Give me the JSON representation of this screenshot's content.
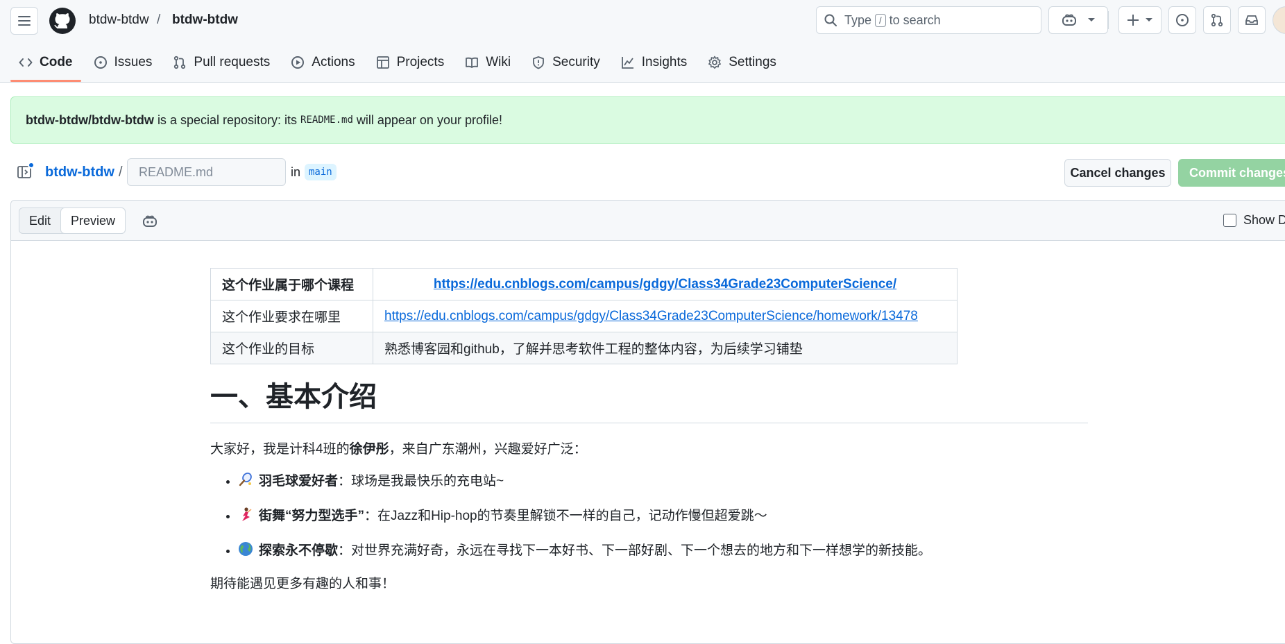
{
  "header": {
    "owner": "btdw-btdw",
    "separator": "/",
    "repo": "btdw-btdw",
    "search_prefix": "Type",
    "search_key": "/",
    "search_suffix": "to search"
  },
  "tabs": [
    {
      "label": "Code",
      "icon": "code-icon",
      "active": true
    },
    {
      "label": "Issues",
      "icon": "issue-icon"
    },
    {
      "label": "Pull requests",
      "icon": "pull-request-icon"
    },
    {
      "label": "Actions",
      "icon": "play-icon"
    },
    {
      "label": "Projects",
      "icon": "table-icon"
    },
    {
      "label": "Wiki",
      "icon": "book-icon"
    },
    {
      "label": "Security",
      "icon": "shield-icon"
    },
    {
      "label": "Insights",
      "icon": "graph-icon"
    },
    {
      "label": "Settings",
      "icon": "gear-icon"
    }
  ],
  "banner": {
    "repo_full": "btdw-btdw/btdw-btdw",
    "text1": "is a special repository: its",
    "code": "README.md",
    "text2": "will appear on your profile!"
  },
  "file": {
    "repo_link": "btdw-btdw",
    "sep": "/",
    "filename_placeholder": "README.md",
    "in_label": "in",
    "branch": "main",
    "cancel_label": "Cancel changes",
    "commit_label": "Commit changes..."
  },
  "editor": {
    "edit_label": "Edit",
    "preview_label": "Preview",
    "show_diff_label": "Show Di"
  },
  "readme": {
    "table": [
      {
        "key": "这个作业属于哪个课程",
        "value": "https://edu.cnblogs.com/campus/gdgy/Class34Grade23ComputerScience/"
      },
      {
        "key": "这个作业要求在哪里",
        "value": "https://edu.cnblogs.com/campus/gdgy/Class34Grade23ComputerScience/homework/13478"
      },
      {
        "key": "这个作业的目标",
        "value": "熟悉博客园和github，了解并思考软件工程的整体内容，为后续学习铺垫"
      }
    ],
    "heading": "一、基本介绍",
    "intro_pre": "大家好，我是计科4班的",
    "intro_name": "徐伊彤",
    "intro_post": "，来自广东潮州，兴趣爱好广泛：",
    "items": [
      {
        "title": "羽毛球爱好者",
        "text": "：球场是我最快乐的充电站~"
      },
      {
        "title": "街舞“努力型选手”",
        "text": "：在Jazz和Hip-hop的节奏里解锁不一样的自己，记动作慢但超爱跳～"
      },
      {
        "title": "探索永不停歇",
        "text": "：对世界充满好奇，永远在寻找下一本好书、下一部好剧、下一个想去的地方和下一样想学的新技能。"
      }
    ],
    "closing": "期待能遇见更多有趣的人和事！"
  }
}
